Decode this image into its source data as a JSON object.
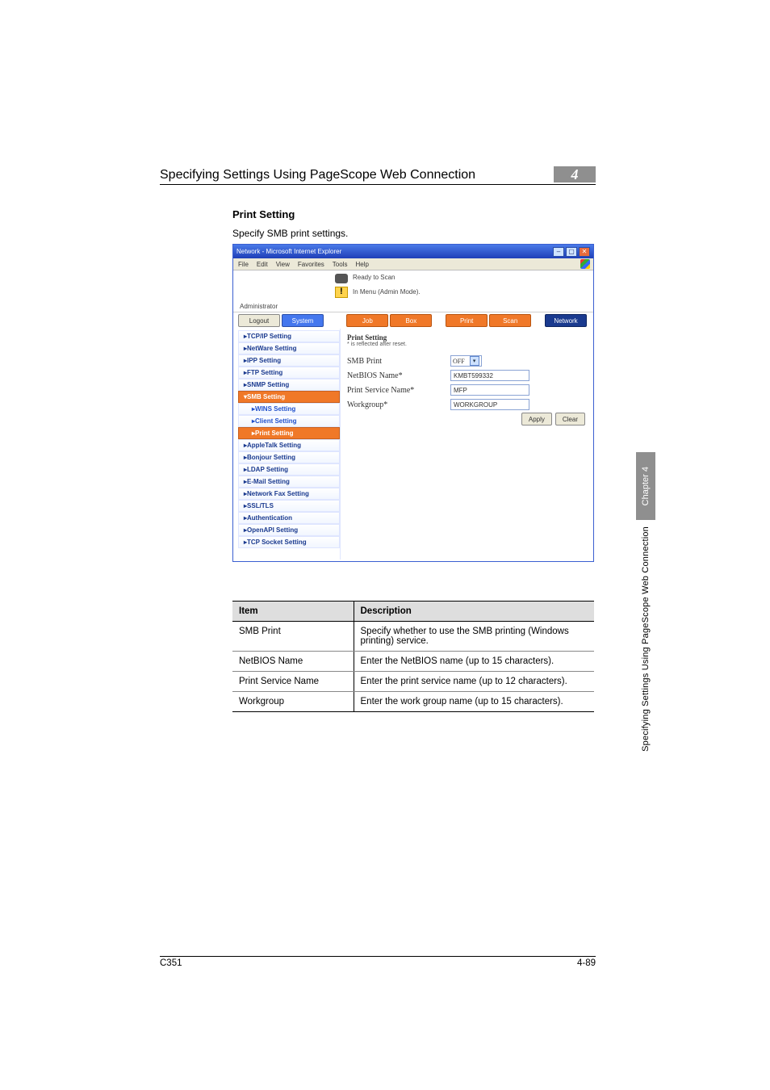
{
  "page": {
    "running_head": "Specifying Settings Using PageScope Web Connection",
    "chapter_tab": "4",
    "side_chapter": "Chapter 4",
    "side_text": "Specifying Settings Using PageScope Web Connection",
    "footer_left": "C351",
    "footer_right": "4-89"
  },
  "section": {
    "title": "Print Setting",
    "body": "Specify SMB print settings."
  },
  "screenshot": {
    "window_title": "Network - Microsoft Internet Explorer",
    "menu": {
      "file": "File",
      "edit": "Edit",
      "view": "View",
      "favorites": "Favorites",
      "tools": "Tools",
      "help": "Help"
    },
    "status1": "Ready to Scan",
    "status2": "In Menu (Admin Mode).",
    "role": "Administrator",
    "logout": "Logout",
    "tabs": {
      "system": "System",
      "job": "Job",
      "box": "Box",
      "print": "Print",
      "scan": "Scan",
      "network": "Network"
    },
    "nav": {
      "tcpip": "TCP/IP Setting",
      "netware": "NetWare Setting",
      "ipp": "IPP Setting",
      "ftp": "FTP Setting",
      "snmp": "SNMP Setting",
      "smb": "SMB Setting",
      "wins": "WINS Setting",
      "client": "Client Setting",
      "print": "Print Setting",
      "appletalk": "AppleTalk Setting",
      "bonjour": "Bonjour Setting",
      "ldap": "LDAP Setting",
      "email": "E-Mail Setting",
      "netfax": "Network Fax Setting",
      "ssltls": "SSL/TLS",
      "auth": "Authentication",
      "openapi": "OpenAPI Setting",
      "tcpsock": "TCP Socket Setting"
    },
    "content": {
      "heading": "Print Setting",
      "note": "* is reflected after reset.",
      "smb_print_lbl": "SMB Print",
      "smb_print_val": "OFF",
      "netbios_lbl": "NetBIOS Name*",
      "netbios_val": "KMBT599332",
      "psn_lbl": "Print Service Name*",
      "psn_val": "MFP",
      "workgroup_lbl": "Workgroup*",
      "workgroup_val": "WORKGROUP",
      "apply": "Apply",
      "clear": "Clear"
    }
  },
  "table": {
    "head_item": "Item",
    "head_desc": "Description",
    "rows": [
      {
        "item": "SMB Print",
        "desc": "Specify whether to use the SMB printing (Windows printing) service."
      },
      {
        "item": "NetBIOS Name",
        "desc": "Enter the NetBIOS name (up to 15 characters)."
      },
      {
        "item": "Print Service Name",
        "desc": "Enter the print service name (up to 12 characters)."
      },
      {
        "item": "Workgroup",
        "desc": "Enter the work group name (up to 15 characters)."
      }
    ]
  }
}
